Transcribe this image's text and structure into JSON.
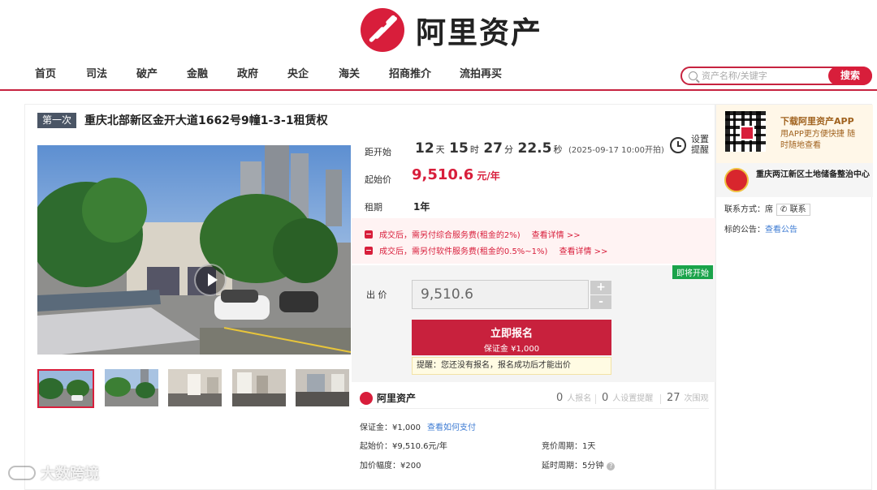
{
  "brand": {
    "name": "阿里资产"
  },
  "nav": {
    "items": [
      "首页",
      "司法",
      "破产",
      "金融",
      "政府",
      "央企",
      "海关",
      "招商推介",
      "流拍再买"
    ]
  },
  "search": {
    "placeholder": "资产名称/关键字",
    "button": "搜索"
  },
  "item": {
    "round": "第一次",
    "title": "重庆北部新区金开大道1662号9幢1-3-1租赁权"
  },
  "countdown": {
    "label": "距开始",
    "days": "12",
    "days_unit": "天",
    "hours": "15",
    "hours_unit": "时",
    "minutes": "27",
    "minutes_unit": "分",
    "seconds": "22.5",
    "seconds_unit": "秒",
    "start_time": "(2025-09-17 10:00开拍)"
  },
  "remind": {
    "label": "设置提醒"
  },
  "start_price": {
    "label": "起始价",
    "value": "9,510.6",
    "unit": "元/年"
  },
  "lease": {
    "label": "租期",
    "value": "1年"
  },
  "fees": [
    {
      "text": "成交后，需另付综合服务费(租金的2%)",
      "link": "查看详情 >>"
    },
    {
      "text": "成交后，需另付软件服务费(租金的0.5%~1%)",
      "link": "查看详情 >>"
    }
  ],
  "bid": {
    "status_badge": "即将开始",
    "label": "出 价",
    "value": "9,510.6",
    "plus": "+",
    "minus": "-",
    "signup_label": "立即报名",
    "deposit_label": "保证金 ¥1,000",
    "tip": "提醒：您还没有报名，报名成功后才能出价"
  },
  "stats": {
    "brand": "阿里资产",
    "signups": "0",
    "signups_label": "人报名",
    "reminders": "0",
    "reminders_label": "人设置提醒",
    "views": "27",
    "views_label": "次围观"
  },
  "details": {
    "deposit": "保证金：¥1,000",
    "deposit_link": "查看如何支付",
    "start_price": "起始价：¥9,510.6元/年",
    "increment": "加价幅度：¥200",
    "cycle": "竞价周期：1天",
    "delay": "延时周期：5分钟",
    "help_icon": "?"
  },
  "sidebar": {
    "app_title": "下载阿里资产APP",
    "app_desc": "用APP更方便快捷 随时随地查看",
    "org_name": "重庆两江新区土地储备整治中心",
    "contact_label": "联系方式：席",
    "contact_button": "联系",
    "notice_label": "标的公告：",
    "notice_link": "查看公告"
  },
  "watermark": "大数跨境",
  "colors": {
    "accent": "#d81e3b",
    "link": "#3d7bd3",
    "soon": "#1aa34a"
  }
}
